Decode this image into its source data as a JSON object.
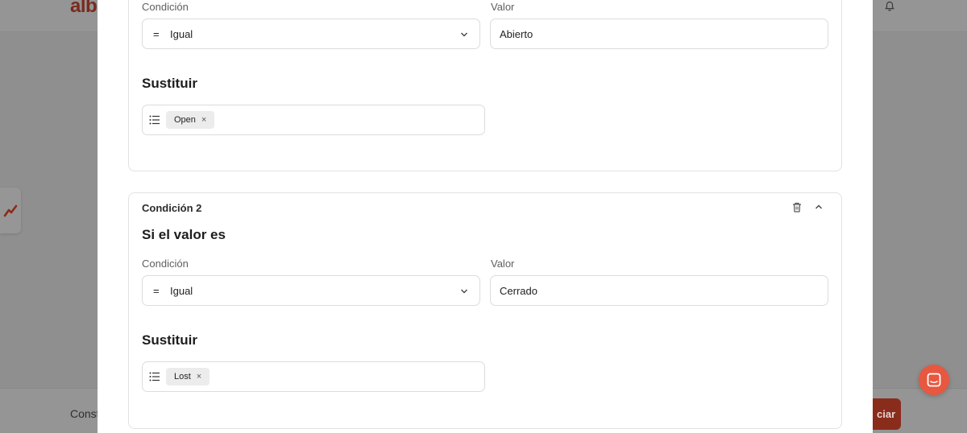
{
  "background": {
    "logo_text": "alb",
    "footer_text": "Const",
    "footer_button_label": "ciar",
    "bell_icon": "bell-icon",
    "side_tab_icon": "analytics-icon"
  },
  "modal": {
    "condition_1": {
      "condition_label": "Condición",
      "value_label": "Valor",
      "operator_symbol": "=",
      "operator_label": "Igual",
      "value": "Abierto",
      "replace_title": "Sustituir",
      "tags": [
        {
          "label": "Open"
        }
      ]
    },
    "condition_2": {
      "title": "Condición 2",
      "if_value_title": "Si el valor es",
      "condition_label": "Condición",
      "value_label": "Valor",
      "operator_symbol": "=",
      "operator_label": "Igual",
      "value": "Cerrado",
      "replace_title": "Sustituir",
      "tags": [
        {
          "label": "Lost"
        }
      ]
    },
    "tag_remove_glyph": "×"
  },
  "colors": {
    "accent": "#e8573f",
    "overlay_background": "#8f8f8f",
    "card_border": "#e2e2e2"
  }
}
